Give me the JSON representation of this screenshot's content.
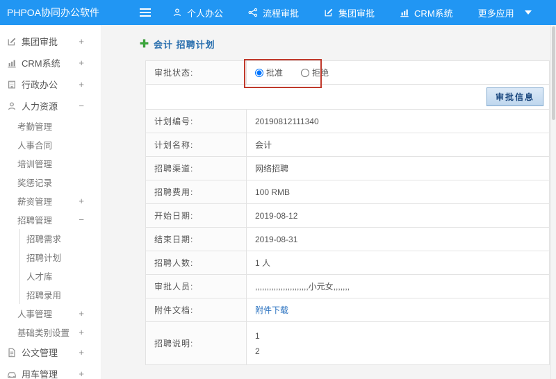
{
  "topbar": {
    "logo": "PHPOA协同办公软件",
    "menu": [
      {
        "label": "个人办公"
      },
      {
        "label": "流程审批"
      },
      {
        "label": "集团审批"
      },
      {
        "label": "CRM系统"
      },
      {
        "label": "更多应用"
      }
    ]
  },
  "sidebar": {
    "top_items": [
      {
        "label": "集团审批",
        "toggle": "+"
      },
      {
        "label": "CRM系统",
        "toggle": "+"
      },
      {
        "label": "行政办公",
        "toggle": "+"
      },
      {
        "label": "人力资源",
        "toggle": "−"
      }
    ],
    "hr_children": [
      {
        "label": "考勤管理",
        "toggle": ""
      },
      {
        "label": "人事合同",
        "toggle": ""
      },
      {
        "label": "培训管理",
        "toggle": ""
      },
      {
        "label": "奖惩记录",
        "toggle": ""
      },
      {
        "label": "薪资管理",
        "toggle": "+"
      },
      {
        "label": "招聘管理",
        "toggle": "−"
      },
      {
        "label": "人事管理",
        "toggle": "+"
      },
      {
        "label": "基础类别设置",
        "toggle": "+"
      }
    ],
    "recruit_children": [
      {
        "label": "招聘需求"
      },
      {
        "label": "招聘计划"
      },
      {
        "label": "人才库"
      },
      {
        "label": "招聘录用"
      }
    ],
    "bottom_items": [
      {
        "label": "公文管理",
        "toggle": "+"
      },
      {
        "label": "用车管理",
        "toggle": "+"
      }
    ]
  },
  "main": {
    "title": "会计 招聘计划",
    "status_label": "审批状态:",
    "radio_approve": "批准",
    "radio_reject": "拒绝",
    "selected_option": "批准",
    "approval_info_button": "审批信息",
    "fields": [
      {
        "label": "计划编号:",
        "value": "20190812111340"
      },
      {
        "label": "计划名称:",
        "value": "会计"
      },
      {
        "label": "招聘渠道:",
        "value": "网络招聘"
      },
      {
        "label": "招聘费用:",
        "value": "100 RMB"
      },
      {
        "label": "开始日期:",
        "value": "2019-08-12"
      },
      {
        "label": "结束日期:",
        "value": "2019-08-31"
      },
      {
        "label": "招聘人数:",
        "value": "1 人"
      },
      {
        "label": "审批人员:",
        "value": ",,,,,,,,,,,,,,,,,,,,,,,小元女,,,,,,,"
      },
      {
        "label": "附件文档:",
        "value": "附件下载"
      },
      {
        "label": "招聘说明:",
        "lines": [
          "1",
          "2"
        ]
      }
    ]
  },
  "colors": {
    "topbar_blue": "#2196f3",
    "title_blue": "#2a6fae",
    "link_blue": "#2a72c0",
    "annotation_red": "#c0392b",
    "button_text": "#17447c"
  }
}
